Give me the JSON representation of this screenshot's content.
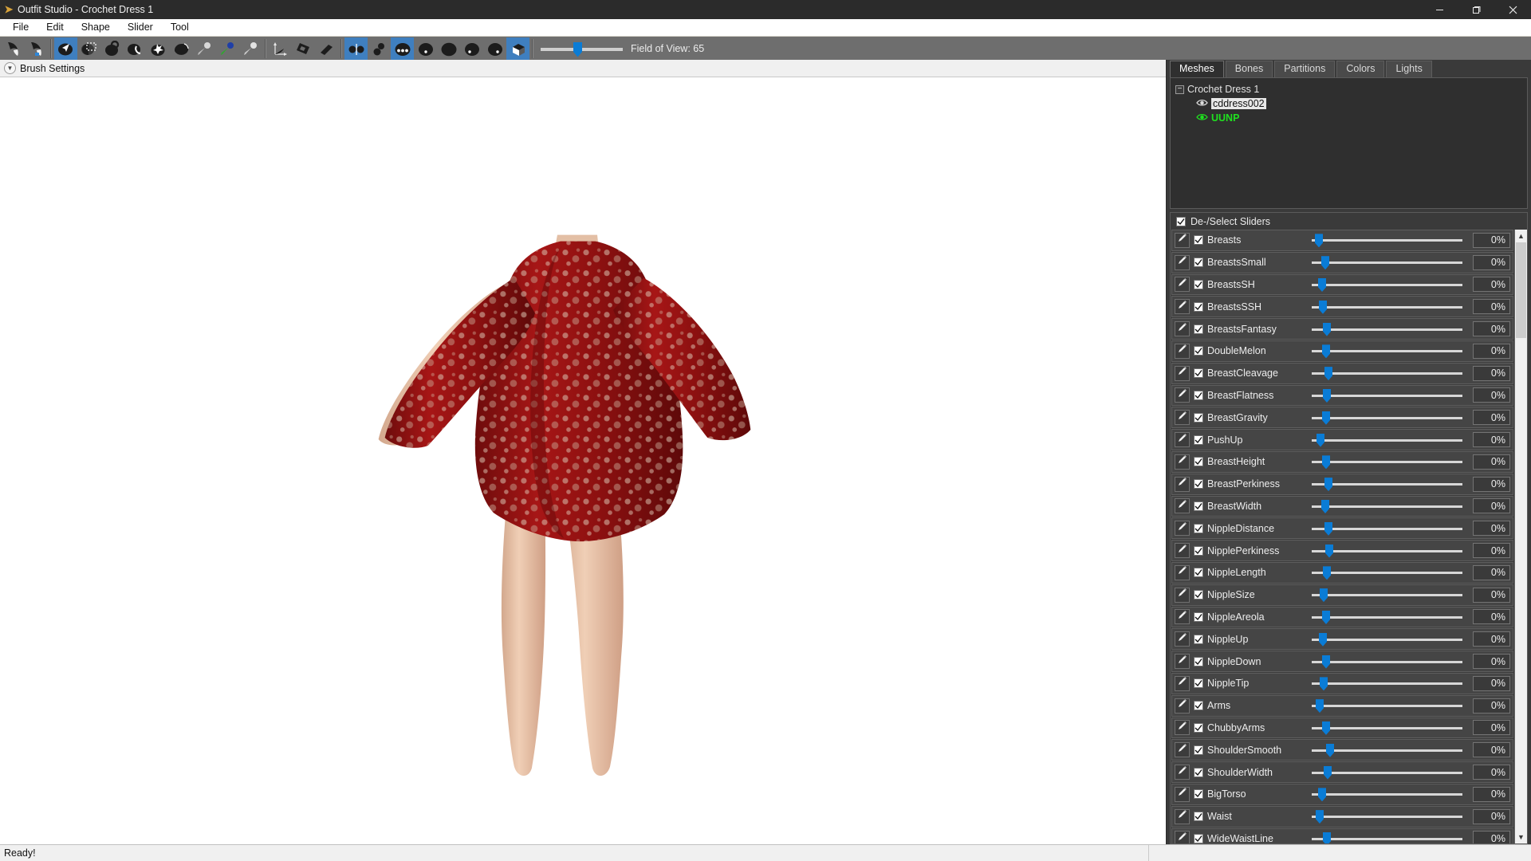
{
  "window": {
    "title": "Outfit Studio - Crochet Dress 1",
    "app_icon": "outfit-studio-icon",
    "minimize_glyph": "─",
    "maximize_glyph": "❐",
    "close_glyph": "✕"
  },
  "menubar": {
    "items": [
      "File",
      "Edit",
      "Shape",
      "Slider",
      "Tool"
    ]
  },
  "toolbar": {
    "fov_label": "Field of View: 65",
    "fov_value": 65,
    "groups": [
      {
        "name": "history",
        "buttons": [
          {
            "name": "undo-button",
            "icon": "undo-icon",
            "active": false
          },
          {
            "name": "redo-button",
            "icon": "redo-icon",
            "active": false
          }
        ]
      },
      {
        "name": "brush-tools",
        "buttons": [
          {
            "name": "select-tool-button",
            "icon": "cursor-arrow-icon",
            "active": true
          },
          {
            "name": "transform-tool-button",
            "icon": "marquee-select-icon",
            "active": false
          },
          {
            "name": "mask-brush-button",
            "icon": "mask-brush-icon",
            "active": false
          },
          {
            "name": "unmask-brush-button",
            "icon": "unmask-brush-icon",
            "active": false
          },
          {
            "name": "move-brush-button",
            "icon": "move-brush-icon",
            "active": false
          },
          {
            "name": "smooth-brush-button",
            "icon": "smooth-brush-icon",
            "active": false
          },
          {
            "name": "inflate-brush-button",
            "icon": "inflate-brush-icon",
            "active": false
          },
          {
            "name": "deflate-brush-button",
            "icon": "deflate-brush-icon",
            "active": false
          },
          {
            "name": "weight-brush-button",
            "icon": "weight-brush-icon",
            "active": false
          }
        ]
      },
      {
        "name": "transform-tools",
        "buttons": [
          {
            "name": "pivot-tool-button",
            "icon": "axis-pivot-icon",
            "active": false
          },
          {
            "name": "vertex-edit-button",
            "icon": "vertex-edit-icon",
            "active": false
          },
          {
            "name": "eraser-button",
            "icon": "eraser-icon",
            "active": false
          }
        ]
      },
      {
        "name": "view-modes",
        "buttons": [
          {
            "name": "show-vertices-button",
            "icon": "vertices-view-icon",
            "active": true
          },
          {
            "name": "show-edges-button",
            "icon": "edges-view-icon",
            "active": false
          },
          {
            "name": "show-wireframe-button",
            "icon": "wireframe-view-icon",
            "active": true
          },
          {
            "name": "show-normals-button",
            "icon": "normals-view-icon",
            "active": false
          },
          {
            "name": "show-smooth-button",
            "icon": "smooth-shading-icon",
            "active": false
          },
          {
            "name": "show-seams-button",
            "icon": "seams-view-icon",
            "active": false
          },
          {
            "name": "show-textures-button",
            "icon": "texture-view-icon",
            "active": false
          },
          {
            "name": "show-lighting-button",
            "icon": "lighting-cube-icon",
            "active": true
          }
        ]
      }
    ]
  },
  "brush_settings": {
    "label": "Brush Settings",
    "expander_icon": "chevron-down-circle-icon",
    "expanded": false
  },
  "viewport": {
    "model_name": "Crochet Dress 1",
    "background_color": "#ffffff",
    "dress_color": "#9c1111",
    "skin_color": "#e8c2a8"
  },
  "right_dock": {
    "tabs": [
      {
        "label": "Meshes",
        "active": true
      },
      {
        "label": "Bones",
        "active": false
      },
      {
        "label": "Partitions",
        "active": false
      },
      {
        "label": "Colors",
        "active": false
      },
      {
        "label": "Lights",
        "active": false
      }
    ],
    "mesh_tree": {
      "root": {
        "label": "Crochet Dress 1",
        "toggle_glyph": "−",
        "expanded": true
      },
      "children": [
        {
          "label": "cddress002",
          "eye_icon": "eye-icon",
          "selected": true,
          "highlight": false
        },
        {
          "label": "UUNP",
          "eye_icon": "eye-icon",
          "selected": false,
          "highlight": true
        }
      ]
    },
    "deselect_sliders": {
      "label": "De-/Select Sliders",
      "checked": true
    },
    "scrollbar": {
      "up_glyph": "▲",
      "down_glyph": "▼"
    },
    "sliders": [
      {
        "name": "Breasts",
        "value": "0%",
        "pos": 4,
        "checked": true,
        "edit_icon": "pencil-icon"
      },
      {
        "name": "BreastsSmall",
        "value": "0%",
        "pos": 12,
        "checked": true,
        "edit_icon": "pencil-icon"
      },
      {
        "name": "BreastsSH",
        "value": "0%",
        "pos": 8,
        "checked": true,
        "edit_icon": "pencil-icon"
      },
      {
        "name": "BreastsSSH",
        "value": "0%",
        "pos": 9,
        "checked": true,
        "edit_icon": "pencil-icon"
      },
      {
        "name": "BreastsFantasy",
        "value": "0%",
        "pos": 14,
        "checked": true,
        "edit_icon": "pencil-icon"
      },
      {
        "name": "DoubleMelon",
        "value": "0%",
        "pos": 13,
        "checked": true,
        "edit_icon": "pencil-icon"
      },
      {
        "name": "BreastCleavage",
        "value": "0%",
        "pos": 16,
        "checked": true,
        "edit_icon": "pencil-icon"
      },
      {
        "name": "BreastFlatness",
        "value": "0%",
        "pos": 14,
        "checked": true,
        "edit_icon": "pencil-icon"
      },
      {
        "name": "BreastGravity",
        "value": "0%",
        "pos": 13,
        "checked": true,
        "edit_icon": "pencil-icon"
      },
      {
        "name": "PushUp",
        "value": "0%",
        "pos": 6,
        "checked": true,
        "edit_icon": "pencil-icon"
      },
      {
        "name": "BreastHeight",
        "value": "0%",
        "pos": 13,
        "checked": true,
        "edit_icon": "pencil-icon"
      },
      {
        "name": "BreastPerkiness",
        "value": "0%",
        "pos": 16,
        "checked": true,
        "edit_icon": "pencil-icon"
      },
      {
        "name": "BreastWidth",
        "value": "0%",
        "pos": 12,
        "checked": true,
        "edit_icon": "pencil-icon"
      },
      {
        "name": "NippleDistance",
        "value": "0%",
        "pos": 16,
        "checked": true,
        "edit_icon": "pencil-icon"
      },
      {
        "name": "NipplePerkiness",
        "value": "0%",
        "pos": 17,
        "checked": true,
        "edit_icon": "pencil-icon"
      },
      {
        "name": "NippleLength",
        "value": "0%",
        "pos": 14,
        "checked": true,
        "edit_icon": "pencil-icon"
      },
      {
        "name": "NippleSize",
        "value": "0%",
        "pos": 10,
        "checked": true,
        "edit_icon": "pencil-icon"
      },
      {
        "name": "NippleAreola",
        "value": "0%",
        "pos": 13,
        "checked": true,
        "edit_icon": "pencil-icon"
      },
      {
        "name": "NippleUp",
        "value": "0%",
        "pos": 9,
        "checked": true,
        "edit_icon": "pencil-icon"
      },
      {
        "name": "NippleDown",
        "value": "0%",
        "pos": 13,
        "checked": true,
        "edit_icon": "pencil-icon"
      },
      {
        "name": "NippleTip",
        "value": "0%",
        "pos": 10,
        "checked": true,
        "edit_icon": "pencil-icon"
      },
      {
        "name": "Arms",
        "value": "0%",
        "pos": 5,
        "checked": true,
        "edit_icon": "pencil-icon"
      },
      {
        "name": "ChubbyArms",
        "value": "0%",
        "pos": 13,
        "checked": true,
        "edit_icon": "pencil-icon"
      },
      {
        "name": "ShoulderSmooth",
        "value": "0%",
        "pos": 18,
        "checked": true,
        "edit_icon": "pencil-icon"
      },
      {
        "name": "ShoulderWidth",
        "value": "0%",
        "pos": 15,
        "checked": true,
        "edit_icon": "pencil-icon"
      },
      {
        "name": "BigTorso",
        "value": "0%",
        "pos": 8,
        "checked": true,
        "edit_icon": "pencil-icon"
      },
      {
        "name": "Waist",
        "value": "0%",
        "pos": 5,
        "checked": true,
        "edit_icon": "pencil-icon"
      },
      {
        "name": "WideWaistLine",
        "value": "0%",
        "pos": 14,
        "checked": true,
        "edit_icon": "pencil-icon"
      }
    ]
  },
  "statusbar": {
    "text": "Ready!"
  }
}
